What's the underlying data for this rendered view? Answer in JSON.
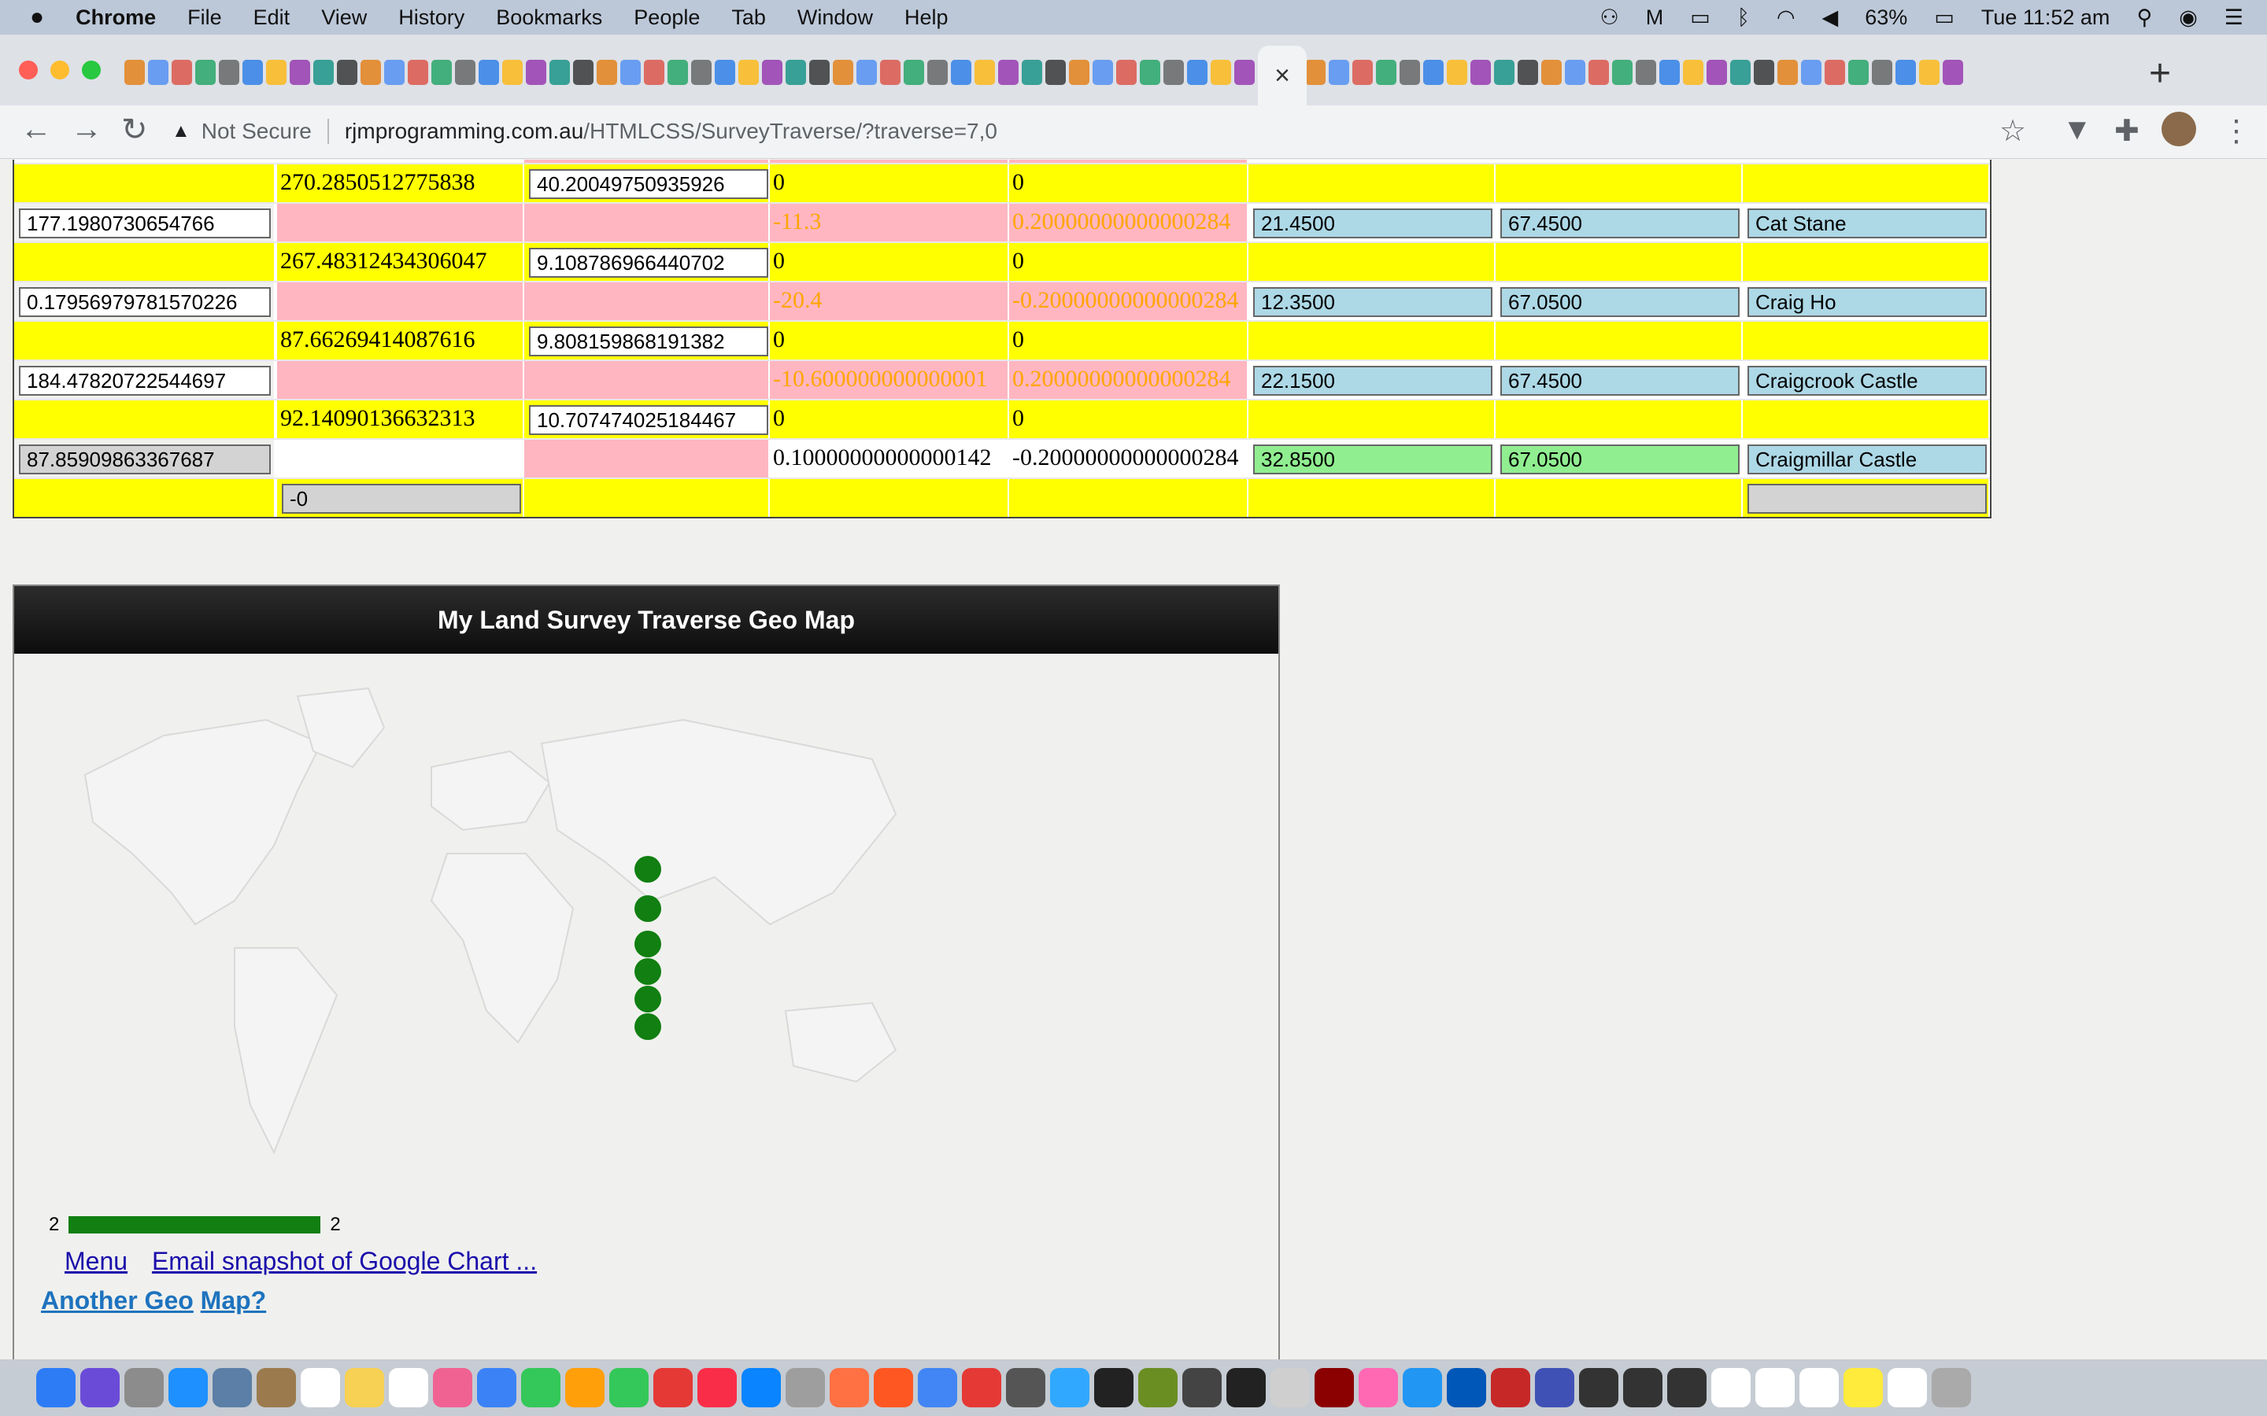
{
  "menubar": {
    "apple": "",
    "app": "Chrome",
    "items": [
      "File",
      "Edit",
      "View",
      "History",
      "Bookmarks",
      "People",
      "Tab",
      "Window",
      "Help"
    ],
    "battery": "63%",
    "clock": "Tue 11:52 am"
  },
  "tab": {
    "close": "×",
    "new": "+"
  },
  "toolbar": {
    "not_secure": "Not Secure",
    "url_domain": "rjmprogramming.com.au",
    "url_path": "/HTMLCSS/SurveyTraverse/?traverse=7,0"
  },
  "table": {
    "rows": [
      {
        "type": "yellow",
        "bearing": "270.2850512775838",
        "distance": "40.20049750935926",
        "dlat": "0",
        "dlong": "0"
      },
      {
        "type": "data",
        "angle": "177.1980730654766",
        "dx": "-11.3",
        "dy": "0.20000000000000284",
        "x": "21.4500",
        "y": "67.4500",
        "name": "Cat Stane"
      },
      {
        "type": "yellow",
        "bearing": "267.48312434306047",
        "distance": "9.108786966440702",
        "dlat": "0",
        "dlong": "0"
      },
      {
        "type": "data",
        "angle": "0.17956979781570226",
        "dx": "-20.4",
        "dy": "-0.20000000000000284",
        "x": "12.3500",
        "y": "67.0500",
        "name": "Craig Ho"
      },
      {
        "type": "yellow",
        "bearing": "87.66269414087616",
        "distance": "9.808159868191382",
        "dlat": "0",
        "dlong": "0"
      },
      {
        "type": "data",
        "angle": "184.47820722544697",
        "dx": "-10.600000000000001",
        "dy": "0.20000000000000284",
        "x": "22.1500",
        "y": "67.4500",
        "name": "Craigcrook Castle"
      },
      {
        "type": "yellow",
        "bearing": "92.14090136632313",
        "distance": "10.707474025184467",
        "dlat": "0",
        "dlong": "0"
      },
      {
        "type": "last",
        "angle": "87.85909863367687",
        "dx": "0.10000000000000142",
        "dy": "-0.20000000000000284",
        "x": "32.8500",
        "y": "67.0500",
        "name": "Craigmillar Castle"
      },
      {
        "type": "final",
        "bearing": "-0"
      }
    ]
  },
  "geo": {
    "title": "My Land Survey Traverse Geo Map",
    "legend_min": "2",
    "legend_max": "2",
    "links": {
      "menu": "Menu",
      "email": "Email snapshot of Google Chart ...",
      "another_1": "Another Geo",
      "another_2": "Map?"
    },
    "marker_color": "#117f11",
    "marker_count": 6
  },
  "colors": {
    "yellow": "#ffff00",
    "pink": "#ffb6c1",
    "blue": "#add8e6",
    "green": "#90ee90",
    "orange": "#ffa500"
  }
}
